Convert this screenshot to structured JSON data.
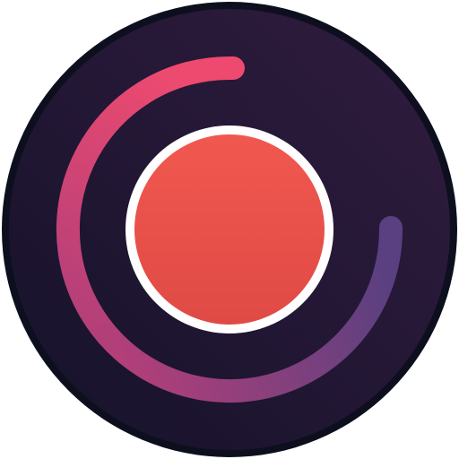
{
  "app_icon": {
    "icon_name": "record-icon",
    "colors": {
      "outer_ring": "#0d0f1e",
      "disc_dark": "#15122a",
      "disc_light": "#311c3f",
      "arc_start": "#ee4a6f",
      "arc_mid": "#b33f79",
      "arc_end": "#5a4080",
      "record_ring": "#ffffff",
      "record_fill_top": "#f0584f",
      "record_fill_bottom": "#e04a45"
    }
  }
}
